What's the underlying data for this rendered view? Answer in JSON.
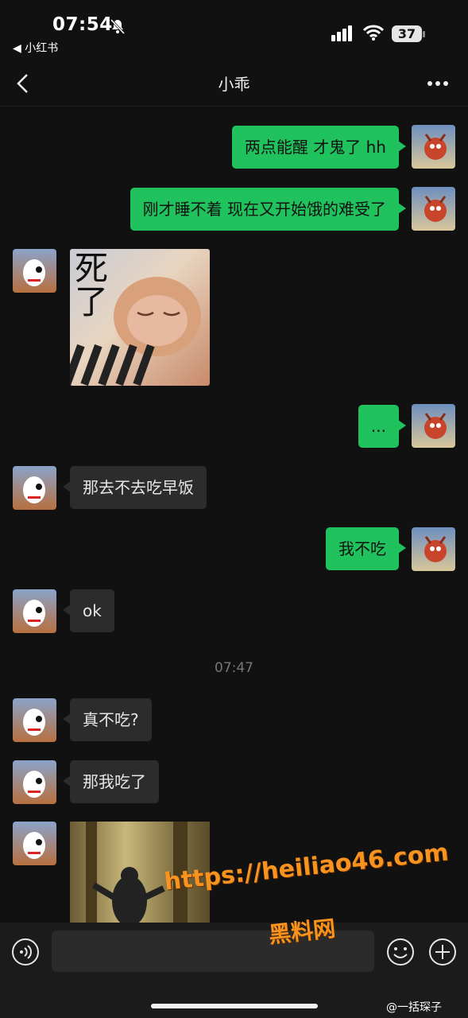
{
  "status": {
    "time": "07:54",
    "back_app": "◀ 小红书",
    "battery": "37"
  },
  "header": {
    "title": "小乖"
  },
  "messages": [
    {
      "text": "两点能醒 才鬼了 hh"
    },
    {
      "text": "刚才睡不着 现在又开始饿的难受了"
    },
    {
      "sticker_caption": "死\n了"
    },
    {
      "text": "..."
    },
    {
      "text": "那去不去吃早饭"
    },
    {
      "text": "我不吃"
    },
    {
      "text": "ok"
    },
    {
      "text": "真不吃?"
    },
    {
      "text": "那我吃了"
    }
  ],
  "timestamp": "07:47",
  "watermark": {
    "url": "https://heiliao46.com",
    "site": "黑料网",
    "weibo": "@一括琛子"
  },
  "colors": {
    "outgoing": "#1fc25c",
    "incoming": "#2c2c2c",
    "background": "#111111"
  },
  "icons": {
    "back": "chevron-left-icon",
    "more": "more-icon",
    "voice": "voice-icon",
    "emoji": "emoji-icon",
    "plus": "plus-icon"
  }
}
